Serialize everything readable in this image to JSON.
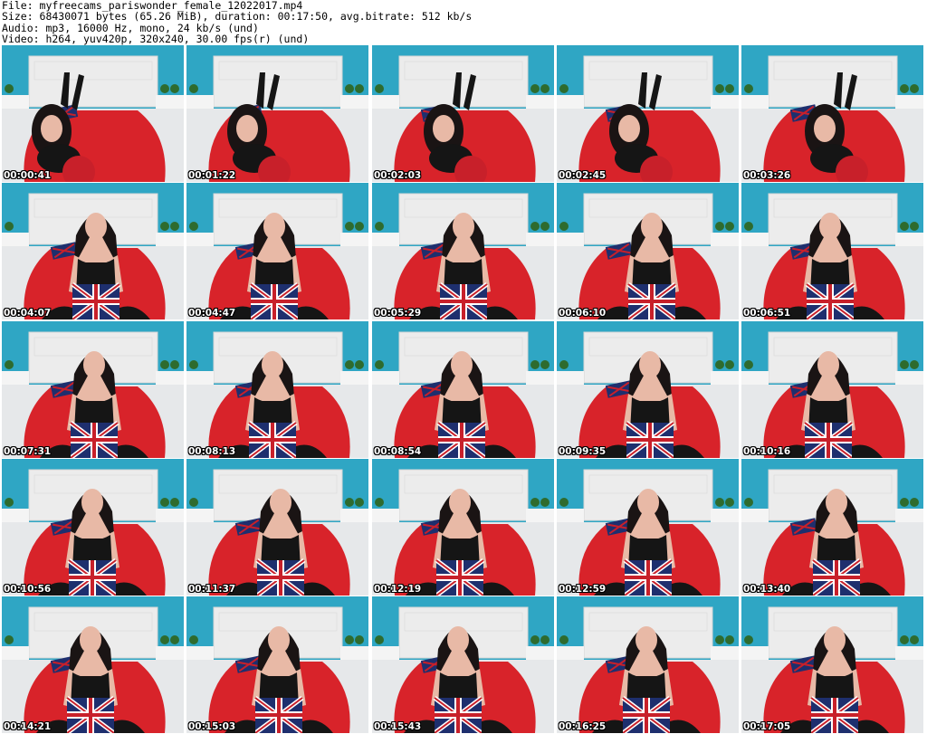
{
  "header": {
    "file_line": "File: myfreecams_pariswonder_female_12022017.mp4",
    "size_line": "Size: 68430071 bytes (65.26 MiB), duration: 00:17:50, avg.bitrate: 512 kb/s",
    "audio_line": "Audio: mp3, 16000 Hz, mono, 24 kb/s (und)",
    "video_line": "Video: h264, yuv420p, 320x240, 30.00 fps(r) (und)"
  },
  "thumbnails": [
    {
      "timestamp": "00:00:41"
    },
    {
      "timestamp": "00:01:22"
    },
    {
      "timestamp": "00:02:03"
    },
    {
      "timestamp": "00:02:45"
    },
    {
      "timestamp": "00:03:26"
    },
    {
      "timestamp": "00:04:07"
    },
    {
      "timestamp": "00:04:47"
    },
    {
      "timestamp": "00:05:29"
    },
    {
      "timestamp": "00:06:10"
    },
    {
      "timestamp": "00:06:51"
    },
    {
      "timestamp": "00:07:31"
    },
    {
      "timestamp": "00:08:13"
    },
    {
      "timestamp": "00:08:54"
    },
    {
      "timestamp": "00:09:35"
    },
    {
      "timestamp": "00:10:16"
    },
    {
      "timestamp": "00:10:56"
    },
    {
      "timestamp": "00:11:37"
    },
    {
      "timestamp": "00:12:19"
    },
    {
      "timestamp": "00:12:59"
    },
    {
      "timestamp": "00:13:40"
    },
    {
      "timestamp": "00:14:21"
    },
    {
      "timestamp": "00:15:03"
    },
    {
      "timestamp": "00:15:43"
    },
    {
      "timestamp": "00:16:25"
    },
    {
      "timestamp": "00:17:05"
    }
  ],
  "colors": {
    "wall": "#2fa6c4",
    "headboard": "#ececec",
    "sheet": "#e6e8ea",
    "blanket": "#d8232a",
    "hair": "#1a1414",
    "skin": "#e8b9a6",
    "top": "#151515",
    "pillow_red": "#c8202a",
    "pillow_blue": "#1e2f6e",
    "plant": "#2e6b2e",
    "table": "#f4f4f4"
  }
}
